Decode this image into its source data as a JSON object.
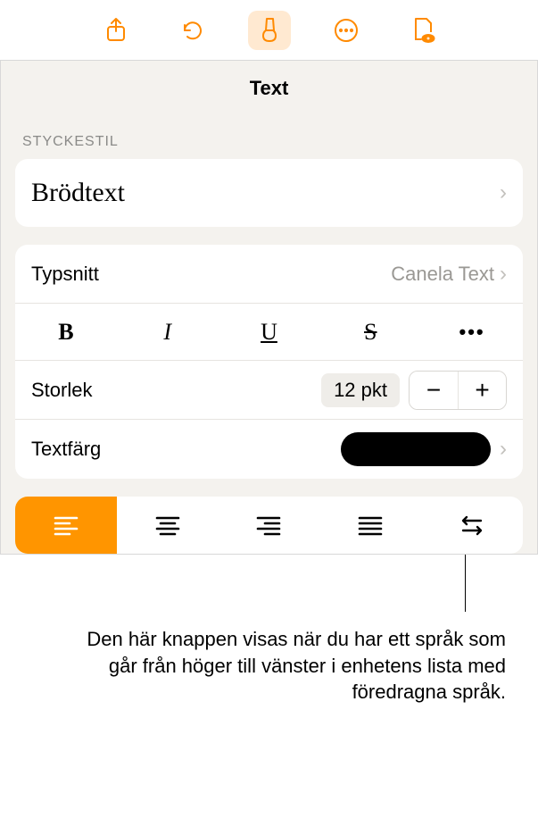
{
  "panel": {
    "title": "Text",
    "section_label": "STYCKESTIL"
  },
  "style": {
    "name": "Brödtext"
  },
  "font": {
    "label": "Typsnitt",
    "value": "Canela Text"
  },
  "format": {
    "bold": "B",
    "italic": "I",
    "underline": "U",
    "strike": "S",
    "more": "•••"
  },
  "size": {
    "label": "Storlek",
    "value": "12 pkt",
    "minus": "−",
    "plus": "+"
  },
  "color": {
    "label": "Textfärg",
    "value": "#000000"
  },
  "callout": {
    "text": "Den här knappen visas när du har ett språk som går från höger till vänster i enhetens lista med föredragna språk."
  }
}
